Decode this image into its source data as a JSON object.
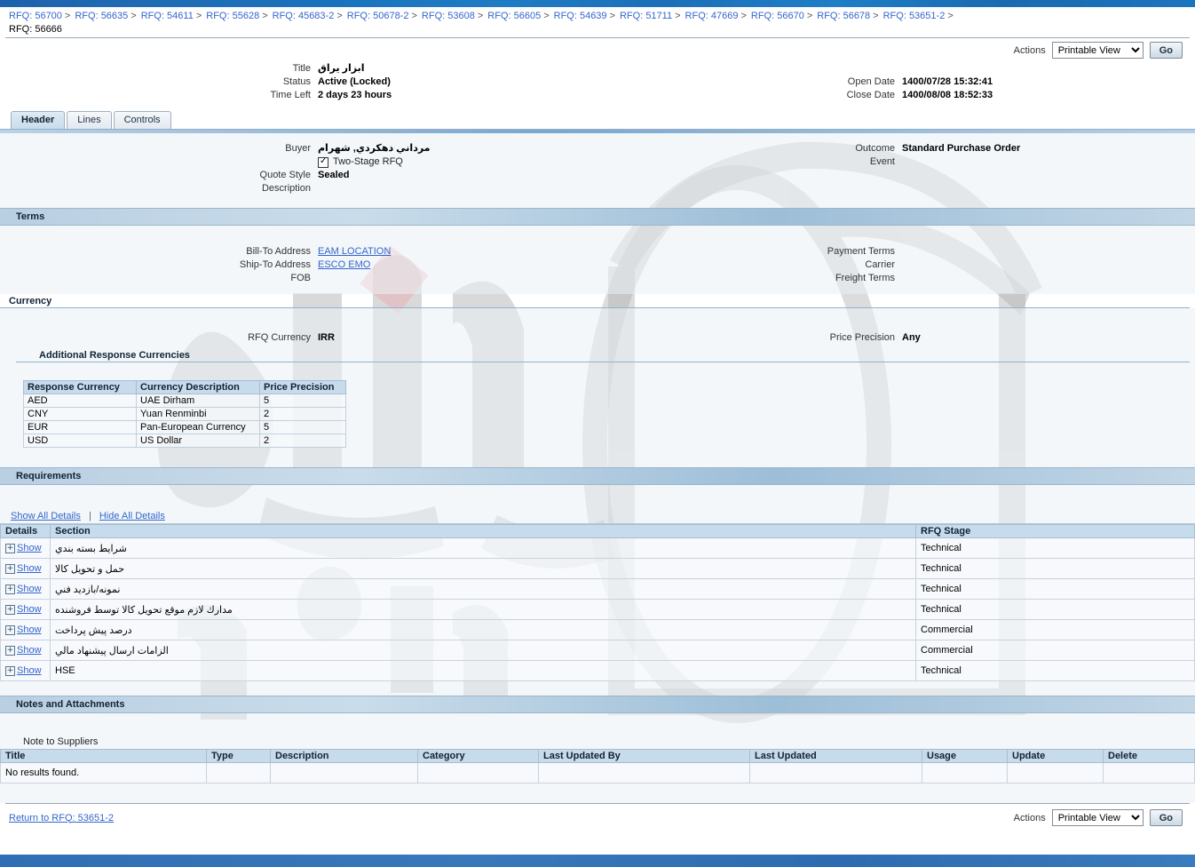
{
  "breadcrumb": {
    "items": [
      "RFQ: 56700",
      "RFQ: 56635",
      "RFQ: 54611",
      "RFQ: 55628",
      "RFQ: 45683-2",
      "RFQ: 50678-2",
      "RFQ: 53608",
      "RFQ: 56605",
      "RFQ: 54639",
      "RFQ: 51711",
      "RFQ: 47669",
      "RFQ: 56670",
      "RFQ: 56678",
      "RFQ: 53651-2"
    ],
    "separator": ">",
    "current": "RFQ: 56666"
  },
  "toolbar": {
    "actions_label": "Actions",
    "view_selected": "Printable View",
    "view_options": [
      "Printable View"
    ],
    "go_label": "Go"
  },
  "summary": {
    "title_label": "Title",
    "title_value": "ابزار يراق",
    "status_label": "Status",
    "status_value": "Active (Locked)",
    "time_left_label": "Time Left",
    "time_left_value": "2 days 23 hours",
    "open_date_label": "Open Date",
    "open_date_value": "1400/07/28 15:32:41",
    "close_date_label": "Close Date",
    "close_date_value": "1400/08/08 18:52:33"
  },
  "tabs": [
    {
      "label": "Header",
      "active": true
    },
    {
      "label": "Lines",
      "active": false
    },
    {
      "label": "Controls",
      "active": false
    }
  ],
  "header_section": {
    "buyer_label": "Buyer",
    "buyer_value": "مرداني دهكردي, شهرام",
    "two_stage_label": "Two-Stage RFQ",
    "two_stage_checked": true,
    "quote_style_label": "Quote Style",
    "quote_style_value": "Sealed",
    "description_label": "Description",
    "description_value": "",
    "outcome_label": "Outcome",
    "outcome_value": "Standard Purchase Order",
    "event_label": "Event",
    "event_value": ""
  },
  "terms": {
    "title": "Terms",
    "bill_to_label": "Bill-To Address",
    "bill_to_value": "EAM LOCATION",
    "ship_to_label": "Ship-To Address",
    "ship_to_value": "ESCO EMO",
    "fob_label": "FOB",
    "fob_value": "",
    "payment_terms_label": "Payment Terms",
    "payment_terms_value": "",
    "carrier_label": "Carrier",
    "carrier_value": "",
    "freight_terms_label": "Freight Terms",
    "freight_terms_value": ""
  },
  "currency": {
    "title": "Currency",
    "rfq_currency_label": "RFQ Currency",
    "rfq_currency_value": "IRR",
    "price_precision_label": "Price Precision",
    "price_precision_value": "Any",
    "additional_title": "Additional Response Currencies",
    "columns": [
      "Response Currency",
      "Currency Description",
      "Price Precision"
    ],
    "rows": [
      [
        "AED",
        "UAE Dirham",
        "5"
      ],
      [
        "CNY",
        "Yuan Renminbi",
        "2"
      ],
      [
        "EUR",
        "Pan-European Currency",
        "5"
      ],
      [
        "USD",
        "US Dollar",
        "2"
      ]
    ]
  },
  "requirements": {
    "title": "Requirements",
    "show_all": "Show All Details",
    "hide_all": "Hide All Details",
    "columns": [
      "Details",
      "Section",
      "RFQ Stage"
    ],
    "show_label": "Show",
    "expand_icon": "+",
    "rows": [
      {
        "section": "شرايط بسته بندي",
        "stage": "Technical"
      },
      {
        "section": "حمل و تحويل كالا",
        "stage": "Technical"
      },
      {
        "section": "نمونه/بازديد فني",
        "stage": "Technical"
      },
      {
        "section": "مدارك لازم موقع تحويل كالا توسط فروشنده",
        "stage": "Technical"
      },
      {
        "section": "درصد پيش پرداخت",
        "stage": "Commercial"
      },
      {
        "section": "الزامات ارسال پيشنهاد مالي",
        "stage": "Commercial"
      },
      {
        "section": "HSE",
        "stage": "Technical"
      }
    ]
  },
  "notes": {
    "title": "Notes and Attachments",
    "note_to_suppliers_label": "Note to Suppliers",
    "note_to_suppliers_value": "",
    "columns": [
      "Title",
      "Type",
      "Description",
      "Category",
      "Last Updated By",
      "Last Updated",
      "Usage",
      "Update",
      "Delete"
    ],
    "empty_message": "No results found."
  },
  "footer": {
    "return_link": "Return to RFQ: 53651-2",
    "actions_label": "Actions",
    "view_selected": "Printable View",
    "go_label": "Go"
  },
  "colors": {
    "accent": "#36c",
    "section_bar": "#b9cfe2",
    "table_header": "#c6dbec",
    "top_bar": "#1d62ab",
    "bottom_bar": "#2f6fb5",
    "panel_bg": "#eaf0f6"
  }
}
